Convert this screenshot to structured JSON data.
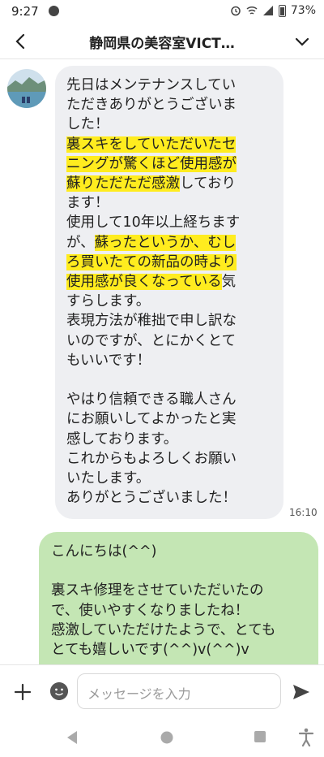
{
  "status_bar": {
    "time": "9:27",
    "battery": "73%"
  },
  "header": {
    "title": "静岡県の美容室VICT…"
  },
  "messages": {
    "incoming": {
      "segments": [
        {
          "text": "先日はメンテナンスしてい\nただきありがとうございま\nした！\n",
          "highlight": false
        },
        {
          "text": "裏スキをしていただいたセ\nニングが驚くほど使用感が\n蘇りただただ感激",
          "highlight": true
        },
        {
          "text": "しており\nます！\n使用して10年以上経ちます\nが、",
          "highlight": false
        },
        {
          "text": "蘇ったというか、むし\nろ買いたての新品の時より\n使用感が良くなっている",
          "highlight": true
        },
        {
          "text": "気\nすらします。\n表現方法が稚拙で申し訳な\nいのですが、とにかくとて\nもいいです！\n\nやはり信頼できる職人さん\nにお願いしてよかったと実\n感しております。\nこれからもよろしくお願い\nいたします。\nありがとうございました！",
          "highlight": false
        }
      ],
      "time": "16:10"
    },
    "outgoing": {
      "text": "こんにちは(^^)\n\n裏スキ修理をさせていただいたの\nで、使いやすくなりましたね！\n感激していただけたようで、とても\nとても嬉しいです(^^)v(^^)v"
    }
  },
  "input_bar": {
    "placeholder": "メッセージを入力"
  },
  "colors": {
    "incoming_bubble": "#eeeff2",
    "outgoing_bubble": "#c4e6b4",
    "highlight": "#ffec1f"
  }
}
